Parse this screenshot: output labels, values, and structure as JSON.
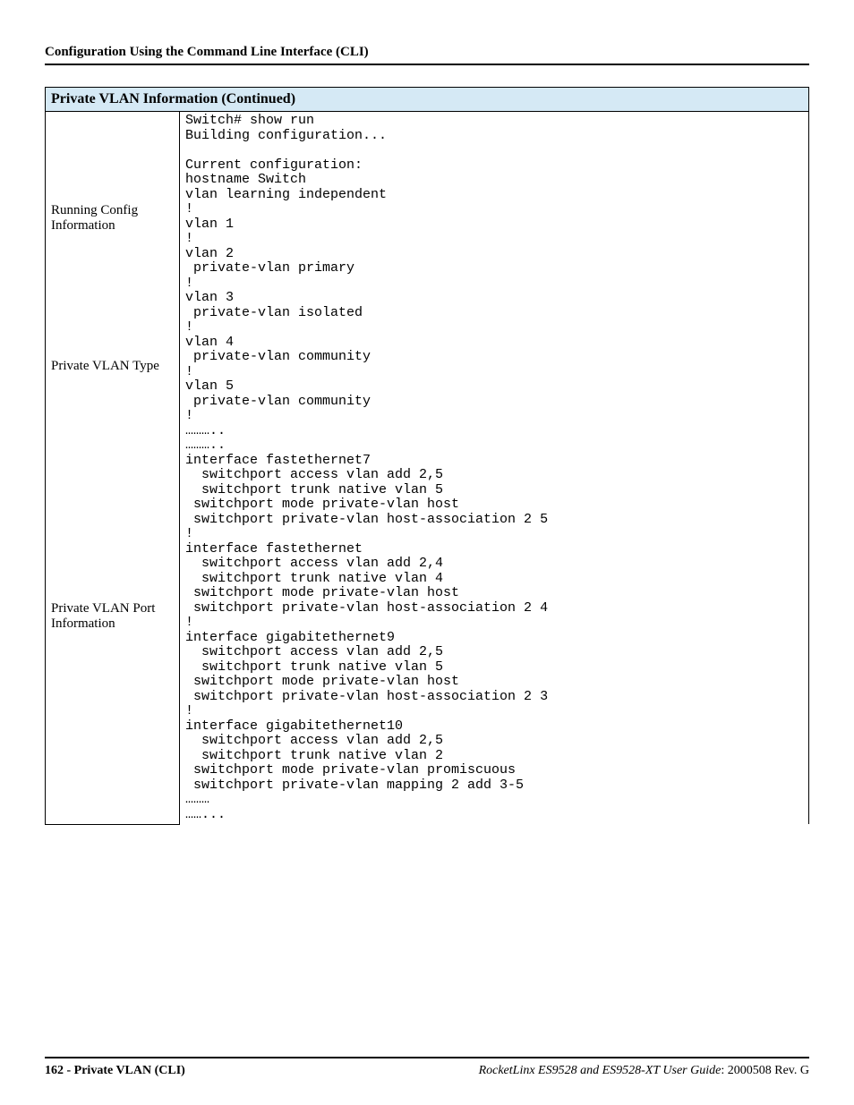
{
  "header": {
    "title": "Configuration Using the Command Line Interface (CLI)"
  },
  "table": {
    "title": "Private VLAN Information (Continued)",
    "rows": [
      {
        "label": "Running Config Information",
        "code": "Switch# show run\nBuilding configuration...\n\nCurrent configuration:\nhostname Switch\nvlan learning independent\n!\nvlan 1\n!\nvlan 2\n private-vlan primary\n!\nvlan 3\n private-vlan isolated\n!\nvlan 4\n private-vlan community\n!"
      },
      {
        "label": "Private VLAN Type",
        "code": "vlan 5\n private-vlan community\n!\n………..\n……….."
      },
      {
        "label": "Private VLAN Port Information",
        "code": "interface fastethernet7\n  switchport access vlan add 2,5\n  switchport trunk native vlan 5\n switchport mode private-vlan host\n switchport private-vlan host-association 2 5\n!\ninterface fastethernet\n  switchport access vlan add 2,4\n  switchport trunk native vlan 4\n switchport mode private-vlan host\n switchport private-vlan host-association 2 4\n!\ninterface gigabitethernet9\n  switchport access vlan add 2,5\n  switchport trunk native vlan 5\n switchport mode private-vlan host\n switchport private-vlan host-association 2 3\n!\ninterface gigabitethernet10\n  switchport access vlan add 2,5\n  switchport trunk native vlan 2\n switchport mode private-vlan promiscuous\n switchport private-vlan mapping 2 add 3-5\n………\n……..."
      }
    ]
  },
  "footer": {
    "page_label": "162 - Private VLAN (CLI)",
    "guide_title": "RocketLinx ES9528 and ES9528-XT User Guide",
    "revision": ": 2000508 Rev. G"
  }
}
